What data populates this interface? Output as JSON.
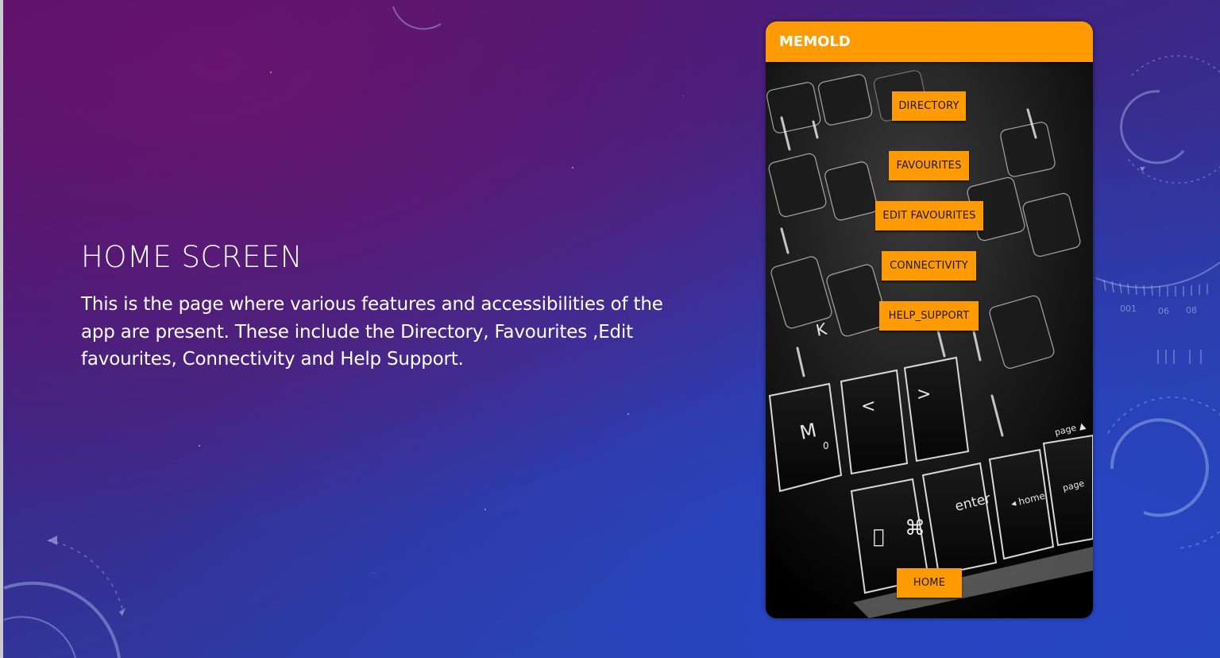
{
  "slide": {
    "title": "HOME SCREEN",
    "body": "This is the page where various features and accessibilities of the app are present. These include the Directory, Favourites ,Edit favourites, Connectivity and Help Support."
  },
  "phone": {
    "app_title": "MEMOLD",
    "accent_color": "#ff9a00",
    "buttons": {
      "directory": "DIRECTORY",
      "favourites": "FAVOURITES",
      "edit_favourites": "EDIT FAVOURITES",
      "connectivity": "CONNECTIVITY",
      "help_support": "HELP_SUPPORT",
      "home": "HOME"
    },
    "background_image": "keyboard-photo"
  },
  "decoration": {
    "ruler_labels": [
      "001",
      "06",
      "08"
    ]
  }
}
